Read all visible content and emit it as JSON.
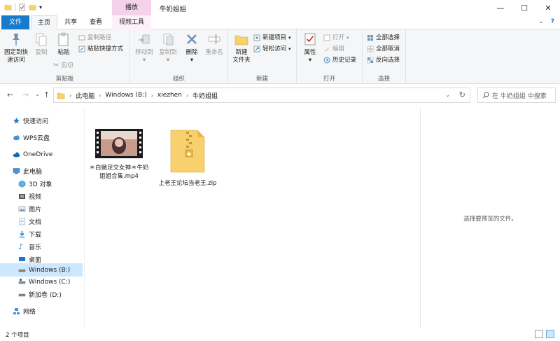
{
  "window": {
    "title": "牛奶姐姐",
    "context_tab_label": "播放",
    "controls": {
      "minimize": "—",
      "maximize": "☐",
      "close": "✕"
    }
  },
  "quick_access": {
    "dropdown": "▾"
  },
  "tabs": {
    "file": "文件",
    "home": "主页",
    "share": "共享",
    "view": "查看",
    "video_tools": "视频工具"
  },
  "help": {
    "expand": "⌄",
    "help": "?"
  },
  "ribbon": {
    "clipboard": {
      "label": "剪贴板",
      "pin": "固定到快\n速访问",
      "copy": "复制",
      "paste": "粘贴",
      "copy_path": "复制路径",
      "paste_shortcut": "粘贴快捷方式",
      "cut": "剪切"
    },
    "organize": {
      "label": "组织",
      "move_to": "移动到",
      "copy_to": "复制到",
      "delete": "删除",
      "rename": "重命名"
    },
    "new": {
      "label": "新建",
      "new_folder": "新建\n文件夹",
      "new_item": "新建项目",
      "easy_access": "轻松访问"
    },
    "open": {
      "label": "打开",
      "properties": "属性",
      "open": "打开",
      "edit": "编辑",
      "history": "历史记录"
    },
    "select": {
      "label": "选择",
      "select_all": "全部选择",
      "select_none": "全部取消",
      "invert": "反向选择"
    },
    "arrow": "▾"
  },
  "address": {
    "back": "←",
    "forward": "→",
    "recent": "⌄",
    "up": "↑",
    "crumbs": [
      "此电脑",
      "Windows (B:)",
      "xiezhen",
      "牛奶姐姐"
    ],
    "sep": "›",
    "dropdown": "⌄",
    "refresh": "↻",
    "search_placeholder": "搜索\"牛奶姐姐\"",
    "search_text": "在 牛奶姐姐 中搜索"
  },
  "nav": {
    "items": [
      {
        "label": "快速访问"
      },
      {
        "label": "WPS云盘"
      },
      {
        "label": "OneDrive"
      },
      {
        "label": "此电脑"
      },
      {
        "label": "3D 对象"
      },
      {
        "label": "视频"
      },
      {
        "label": "图片"
      },
      {
        "label": "文档"
      },
      {
        "label": "下载"
      },
      {
        "label": "音乐"
      },
      {
        "label": "桌面"
      },
      {
        "label": "Windows (B:)"
      },
      {
        "label": "Windows (C:)"
      },
      {
        "label": "新加卷 (D:)"
      },
      {
        "label": "网络"
      }
    ],
    "expander": "›"
  },
  "files": [
    {
      "name": "＊白嫩足交女神＊牛奶姐姐合集.mp4",
      "type": "video"
    },
    {
      "name": "上老王论坛当老王.zip",
      "type": "zip"
    }
  ],
  "preview": {
    "text": "选择要预览的文件。"
  },
  "status": {
    "count": "2 个项目"
  },
  "colors": {
    "accent": "#1979ca",
    "selected": "#cce8ff",
    "context_tab": "#f4d3ea",
    "folder": "#f8d16e"
  }
}
